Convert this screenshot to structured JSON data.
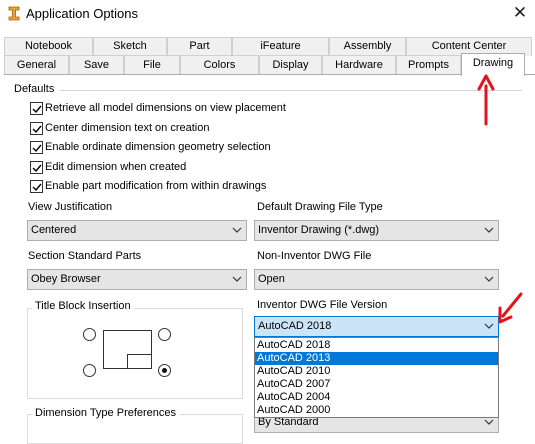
{
  "window": {
    "title": "Application Options",
    "close_glyph": "✕"
  },
  "tabs_row1": [
    "Notebook",
    "Sketch",
    "Part",
    "iFeature",
    "Assembly",
    "Content Center"
  ],
  "tabs_row2": [
    "General",
    "Save",
    "File",
    "Colors",
    "Display",
    "Hardware",
    "Prompts",
    "Drawing"
  ],
  "active_tab": "Drawing",
  "defaults": {
    "title": "Defaults",
    "checkboxes": [
      {
        "label": "Retrieve all model dimensions on view placement",
        "checked": true
      },
      {
        "label": "Center dimension text on creation",
        "checked": true
      },
      {
        "label": "Enable ordinate dimension geometry selection",
        "checked": true
      },
      {
        "label": "Edit dimension when created",
        "checked": true
      },
      {
        "label": "Enable part modification from within drawings",
        "checked": true
      }
    ]
  },
  "view_justification": {
    "label": "View Justification",
    "value": "Centered"
  },
  "default_drawing_file_type": {
    "label": "Default Drawing File Type",
    "value": "Inventor Drawing (*.dwg)"
  },
  "section_standard_parts": {
    "label": "Section Standard Parts",
    "value": "Obey Browser"
  },
  "non_inventor_dwg_file": {
    "label": "Non-Inventor DWG File",
    "value": "Open"
  },
  "title_block_insertion": {
    "title": "Title Block Insertion",
    "selected": "bottom-right"
  },
  "inventor_dwg_file_version": {
    "label": "Inventor DWG File Version",
    "value": "AutoCAD 2018",
    "options": [
      "AutoCAD 2018",
      "AutoCAD 2013",
      "AutoCAD 2010",
      "AutoCAD 2007",
      "AutoCAD 2004",
      "AutoCAD 2000"
    ],
    "highlighted": "AutoCAD 2013"
  },
  "dimension_type_preferences": {
    "title": "Dimension Type Preferences"
  },
  "bottom_combo": {
    "value": "By Standard"
  },
  "colors": {
    "annotation_arrow": "#e0141e",
    "selection": "#0078d7",
    "open_combo": "#cce4f7"
  }
}
